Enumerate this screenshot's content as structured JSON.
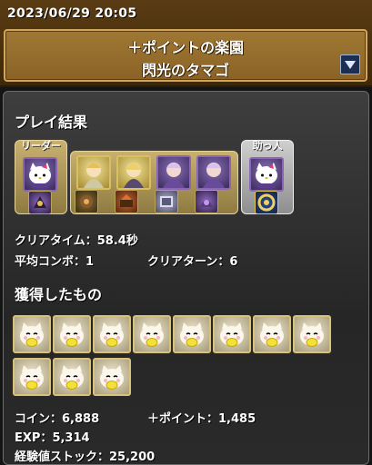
{
  "header": {
    "datetime": "2023/06/29 20:05",
    "dungeon_name": "＋ポイントの楽園",
    "floor_name": "閃光のタマゴ",
    "expand_icon": "triangle-down-icon"
  },
  "play_result": {
    "title": "プレイ結果",
    "leader_label": "リーダー",
    "helper_label": "助っ人",
    "clear_time_label": "クリアタイム：",
    "clear_time_value": "58.4秒",
    "avg_combo_label": "平均コンボ：",
    "avg_combo_value": "1",
    "clear_turn_label": "クリアターン：",
    "clear_turn_value": "6"
  },
  "rewards": {
    "title": "獲得したもの",
    "drop_count": 11,
    "coin_label": "コイン：",
    "coin_value": "6,888",
    "plus_point_label": "＋ポイント：",
    "plus_point_value": "1,485",
    "exp_label": "EXP：",
    "exp_value": "5,314",
    "exp_stock_label": "経験値ストック：",
    "exp_stock_value": "25,200"
  },
  "colors": {
    "header_bg": "#5a3c14",
    "title_box": "#a07834",
    "panel_bg": "#2e2e2e",
    "team_frame_gold": "#c8b070",
    "helper_frame_silver": "#cfcfcf"
  }
}
